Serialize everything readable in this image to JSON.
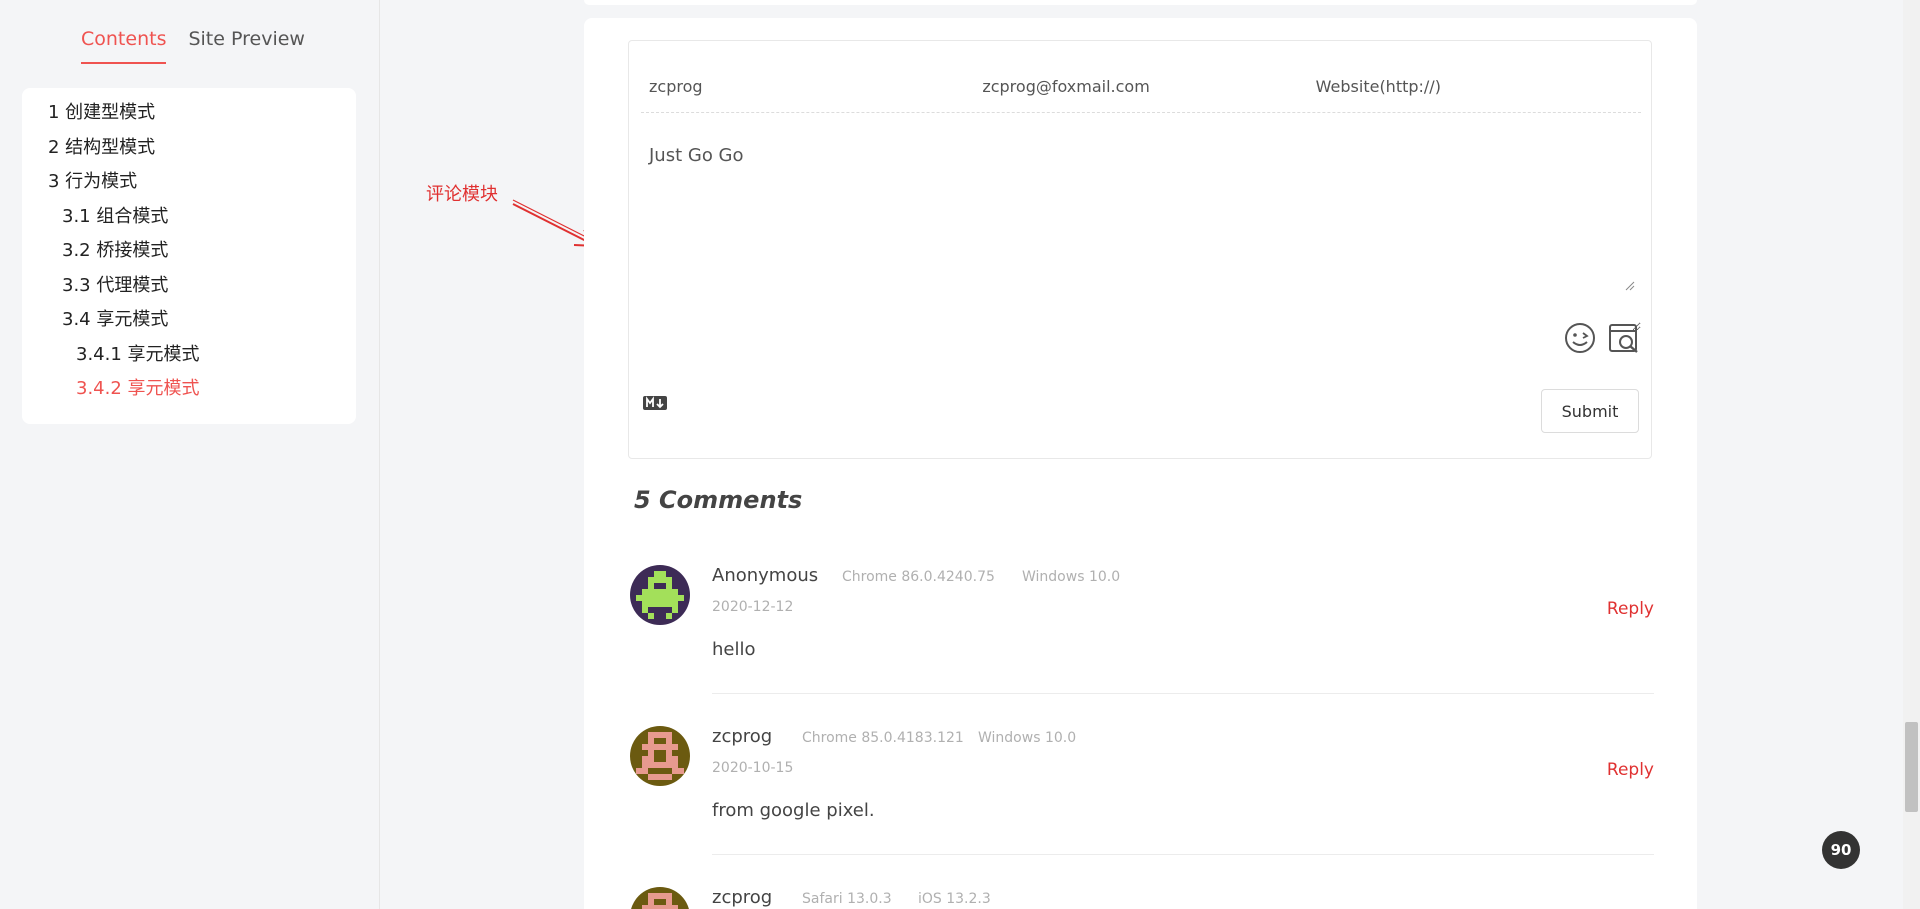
{
  "sidebar": {
    "tabs": [
      {
        "label": "Contents",
        "active": true
      },
      {
        "label": "Site Preview",
        "active": false
      }
    ],
    "toc": [
      {
        "label": "1 创建型模式",
        "level": 1
      },
      {
        "label": "2 结构型模式",
        "level": 1
      },
      {
        "label": "3 行为模式",
        "level": 1
      },
      {
        "label": "3.1 组合模式",
        "level": 2
      },
      {
        "label": "3.2 桥接模式",
        "level": 2
      },
      {
        "label": "3.3 代理模式",
        "level": 2
      },
      {
        "label": "3.4 享元模式",
        "level": 2
      },
      {
        "label": "3.4.1 享元模式",
        "level": 3
      },
      {
        "label": "3.4.2 享元模式",
        "level": 3,
        "active": true
      }
    ]
  },
  "annotation": {
    "label": "评论模块",
    "color": "#e03131"
  },
  "comment_form": {
    "nick_value": "zcprog",
    "email_value": "zcprog@foxmail.com",
    "website_placeholder": "Website(http://)",
    "content_value": "Just Go Go",
    "submit_label": "Submit",
    "icons": [
      "emoji-icon",
      "preview-icon",
      "markdown-icon"
    ]
  },
  "comments": {
    "count_label": "5 Comments",
    "items": [
      {
        "nick": "Anonymous",
        "browser": "Chrome 86.0.4240.75",
        "os": "Windows 10.0",
        "date": "2020-12-12",
        "content": "hello",
        "reply_label": "Reply",
        "avatar_bg": "#3d2b56",
        "avatar_fg": "#a3e05a"
      },
      {
        "nick": "zcprog",
        "browser": "Chrome 85.0.4183.121",
        "os": "Windows 10.0",
        "date": "2020-10-15",
        "content": "from google pixel.",
        "reply_label": "Reply",
        "avatar_bg": "#6b5a10",
        "avatar_fg": "#e79a8f"
      },
      {
        "nick": "zcprog",
        "browser": "Safari 13.0.3",
        "os": "iOS 13.2.3",
        "avatar_bg": "#6b5a10",
        "avatar_fg": "#e79a8f"
      }
    ]
  },
  "reading_progress": "90",
  "colors": {
    "accent": "#ef5350",
    "reply": "#e03131"
  }
}
